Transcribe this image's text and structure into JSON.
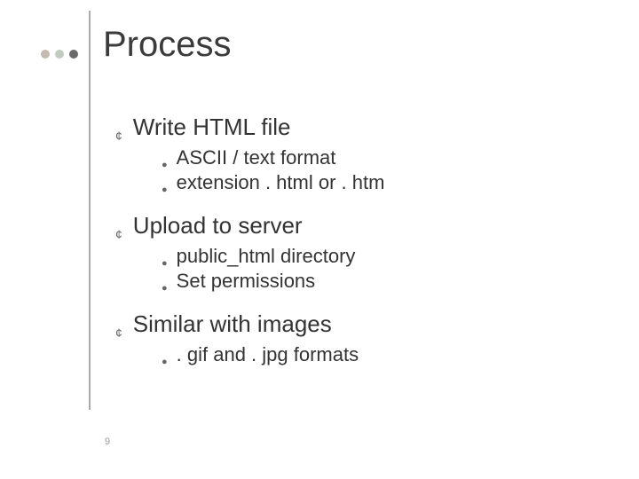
{
  "slide": {
    "title": "Process",
    "page_number": "9",
    "bullets": [
      {
        "text": "Write HTML file",
        "sub": [
          {
            "text": "ASCII / text format"
          },
          {
            "text": "extension . html or . htm"
          }
        ]
      },
      {
        "text": "Upload to server",
        "sub": [
          {
            "text": "public_html directory"
          },
          {
            "text": "Set permissions"
          }
        ]
      },
      {
        "text": "Similar with images",
        "sub": [
          {
            "text": ". gif and . jpg formats"
          }
        ]
      }
    ]
  }
}
